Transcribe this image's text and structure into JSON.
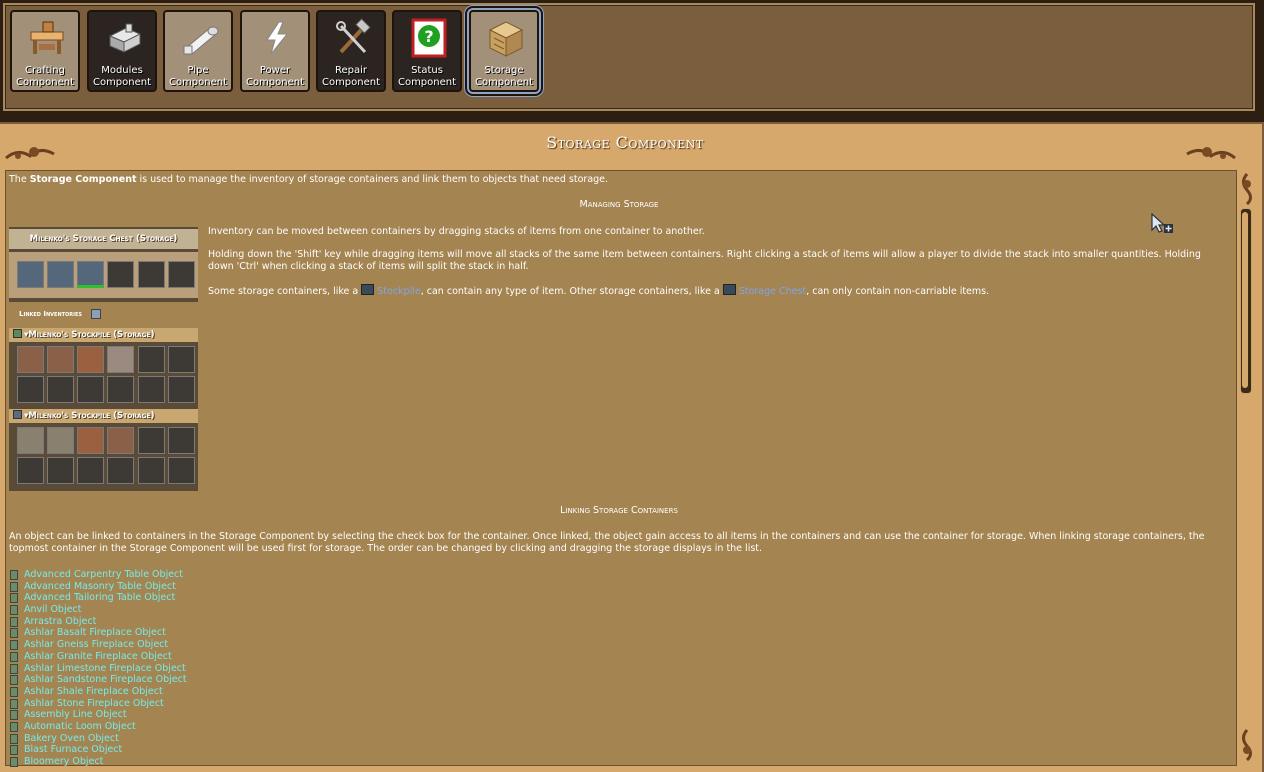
{
  "components": [
    {
      "label": "Crafting Component",
      "icon": "crafting-table-icon",
      "style": "light"
    },
    {
      "label": "Modules Component",
      "icon": "modules-icon",
      "style": "dark"
    },
    {
      "label": "Pipe Component",
      "icon": "pipe-icon",
      "style": "light"
    },
    {
      "label": "Power Component",
      "icon": "power-bolt-icon",
      "style": "light"
    },
    {
      "label": "Repair Component",
      "icon": "repair-tools-icon",
      "style": "dark"
    },
    {
      "label": "Status Component",
      "icon": "status-question-icon",
      "style": "dark"
    },
    {
      "label": "Storage Component",
      "icon": "storage-crate-icon",
      "style": "selected"
    }
  ],
  "page": {
    "title": "Storage Component",
    "intro_pre": "The ",
    "intro_bold": "Storage Component",
    "intro_post": " is used to manage the inventory of storage containers and link them to objects that need storage."
  },
  "managing": {
    "heading": "Managing Storage",
    "p1": "Inventory can be moved between containers by dragging stacks of items from one container to another.",
    "p2a": "Holding down the 'Shift' key while dragging items will move all stacks of the same item between containers. Right clicking a stack of items will allow a player to divide the stack into smaller quantities. Holding",
    "p2b": "down 'Ctrl' when clicking a stack of items will split the stack in half.",
    "p3_pre": "Some storage containers, like a ",
    "p3_link1": "Stockpile",
    "p3_mid": ", can contain any type of item. Other storage containers, like a ",
    "p3_link2": "Storage Chest",
    "p3_post": ", can only contain non-carriable items."
  },
  "inventory": {
    "chest_title": "Milenko's Storage Chest (Storage)",
    "linked_label": "Linked Inventories",
    "stockpile1_title": "Milenko's Stockpile (Storage)",
    "stockpile2_title": "Milenko's Stockpile (Storage)"
  },
  "linking": {
    "heading": "Linking Storage Containers",
    "p1a": "An object can be linked to containers in the Storage Component by selecting the check box for the container. Once linked, the object gain access to all items in the containers and can use the container for storage. When linking storage containers, the",
    "p1b": "topmost container in the Storage Component will be used first for storage.  The order can be changed by clicking and dragging the storage displays in the list."
  },
  "objects": [
    "Advanced Carpentry Table Object",
    "Advanced Masonry Table Object",
    "Advanced Tailoring Table Object",
    "Anvil Object",
    "Arrastra Object",
    "Ashlar Basalt Fireplace Object",
    "Ashlar Gneiss Fireplace Object",
    "Ashlar Granite Fireplace Object",
    "Ashlar Limestone Fireplace Object",
    "Ashlar Sandstone Fireplace Object",
    "Ashlar Shale Fireplace Object",
    "Ashlar Stone Fireplace Object",
    "Assembly Line Object",
    "Automatic Loom Object",
    "Bakery Oven Object",
    "Blast Furnace Object",
    "Bloomery Object"
  ],
  "colors": {
    "link": "#7fa6e8",
    "object_link": "#74ecec",
    "panel": "#a48451",
    "frame": "#d6a86c"
  }
}
